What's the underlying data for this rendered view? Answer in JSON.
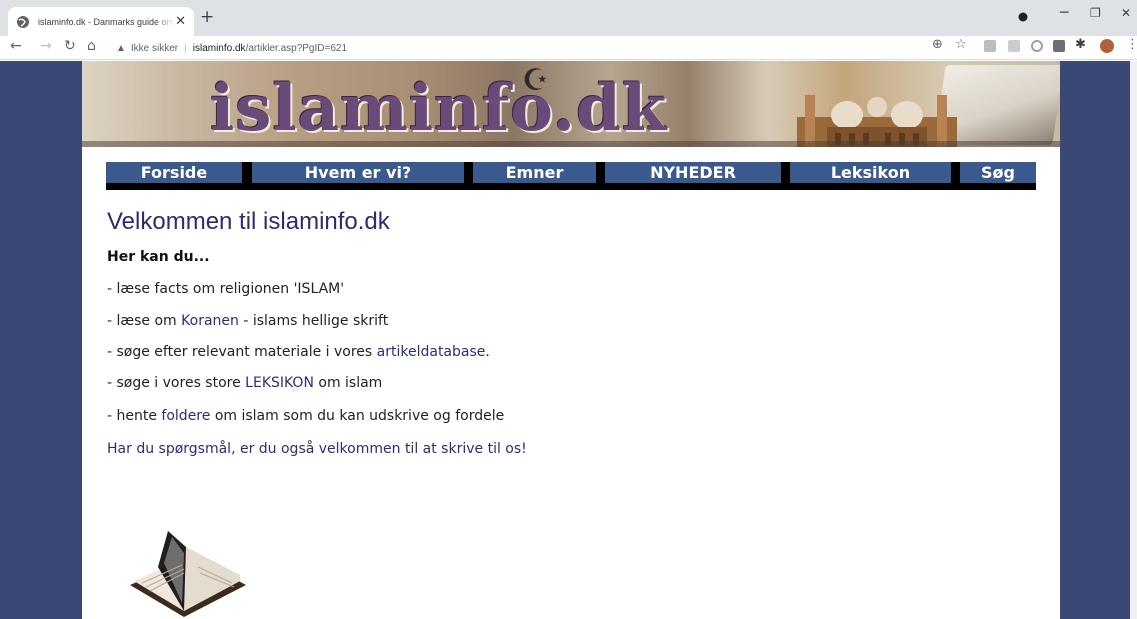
{
  "browser": {
    "tab_title": "islaminfo.dk - Danmarks guide om Islam",
    "close_tab": "✕",
    "new_tab": "+",
    "security_label": "Ikke sikker",
    "url_host": "islaminfo.dk",
    "url_path": "/artikler.asp?PgID=621"
  },
  "nav": {
    "items": [
      {
        "label": "Forside"
      },
      {
        "label": "Hvem er vi?"
      },
      {
        "label": "Emner"
      },
      {
        "label": "NYHEDER"
      },
      {
        "label": "Leksikon"
      },
      {
        "label": "Søg"
      }
    ]
  },
  "banner": {
    "logo_text": "islaminfo.dk"
  },
  "content": {
    "title": "Velkommen til islaminfo.dk",
    "intro": "Her kan du...",
    "lines": [
      {
        "pre": "- læse facts om religionen 'ISLAM'",
        "link": "",
        "post": ""
      },
      {
        "pre": "- læse om ",
        "link": "Koranen",
        "post": " - islams hellige skrift"
      },
      {
        "pre": "- søge efter relevant materiale i vores ",
        "link": "artikeldatabase",
        "post": "."
      },
      {
        "pre": "- søge i vores store ",
        "link": "LEKSIKON",
        "post": " om islam"
      },
      {
        "pre": "- hente ",
        "link": "foldere",
        "post": " om islam som du kan udskrive og fordele"
      }
    ],
    "cta": "Har du spørgsmål, er du også velkommen til at skrive til os!"
  },
  "colors": {
    "sidebar": "#3a4876",
    "nav_button": "#3a5a8e",
    "heading": "#2b2d6e",
    "link": "#27307a"
  }
}
